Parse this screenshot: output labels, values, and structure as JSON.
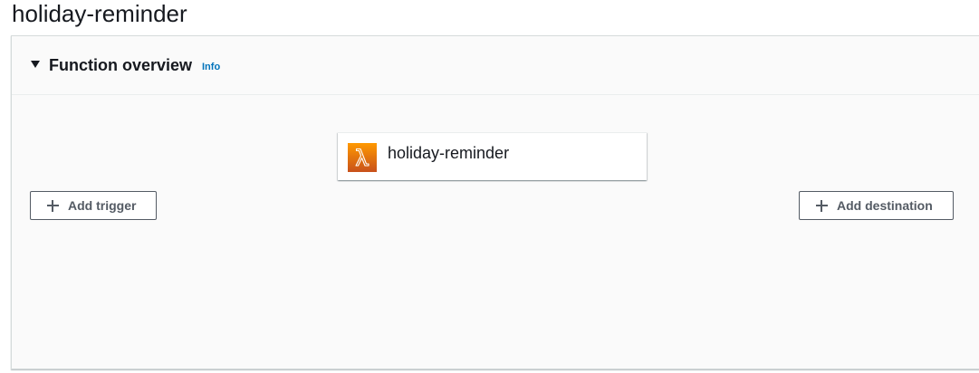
{
  "page": {
    "title": "holiday-reminder"
  },
  "function_overview": {
    "heading": "Function overview",
    "info_link": "Info",
    "function_card": {
      "name": "holiday-reminder",
      "icon": "lambda-icon",
      "icon_color": "#ff9900"
    },
    "add_trigger_label": "Add trigger",
    "add_destination_label": "Add destination"
  },
  "colors": {
    "link": "#0073bb",
    "button_border": "#545b64",
    "panel_background": "#fafafa"
  }
}
